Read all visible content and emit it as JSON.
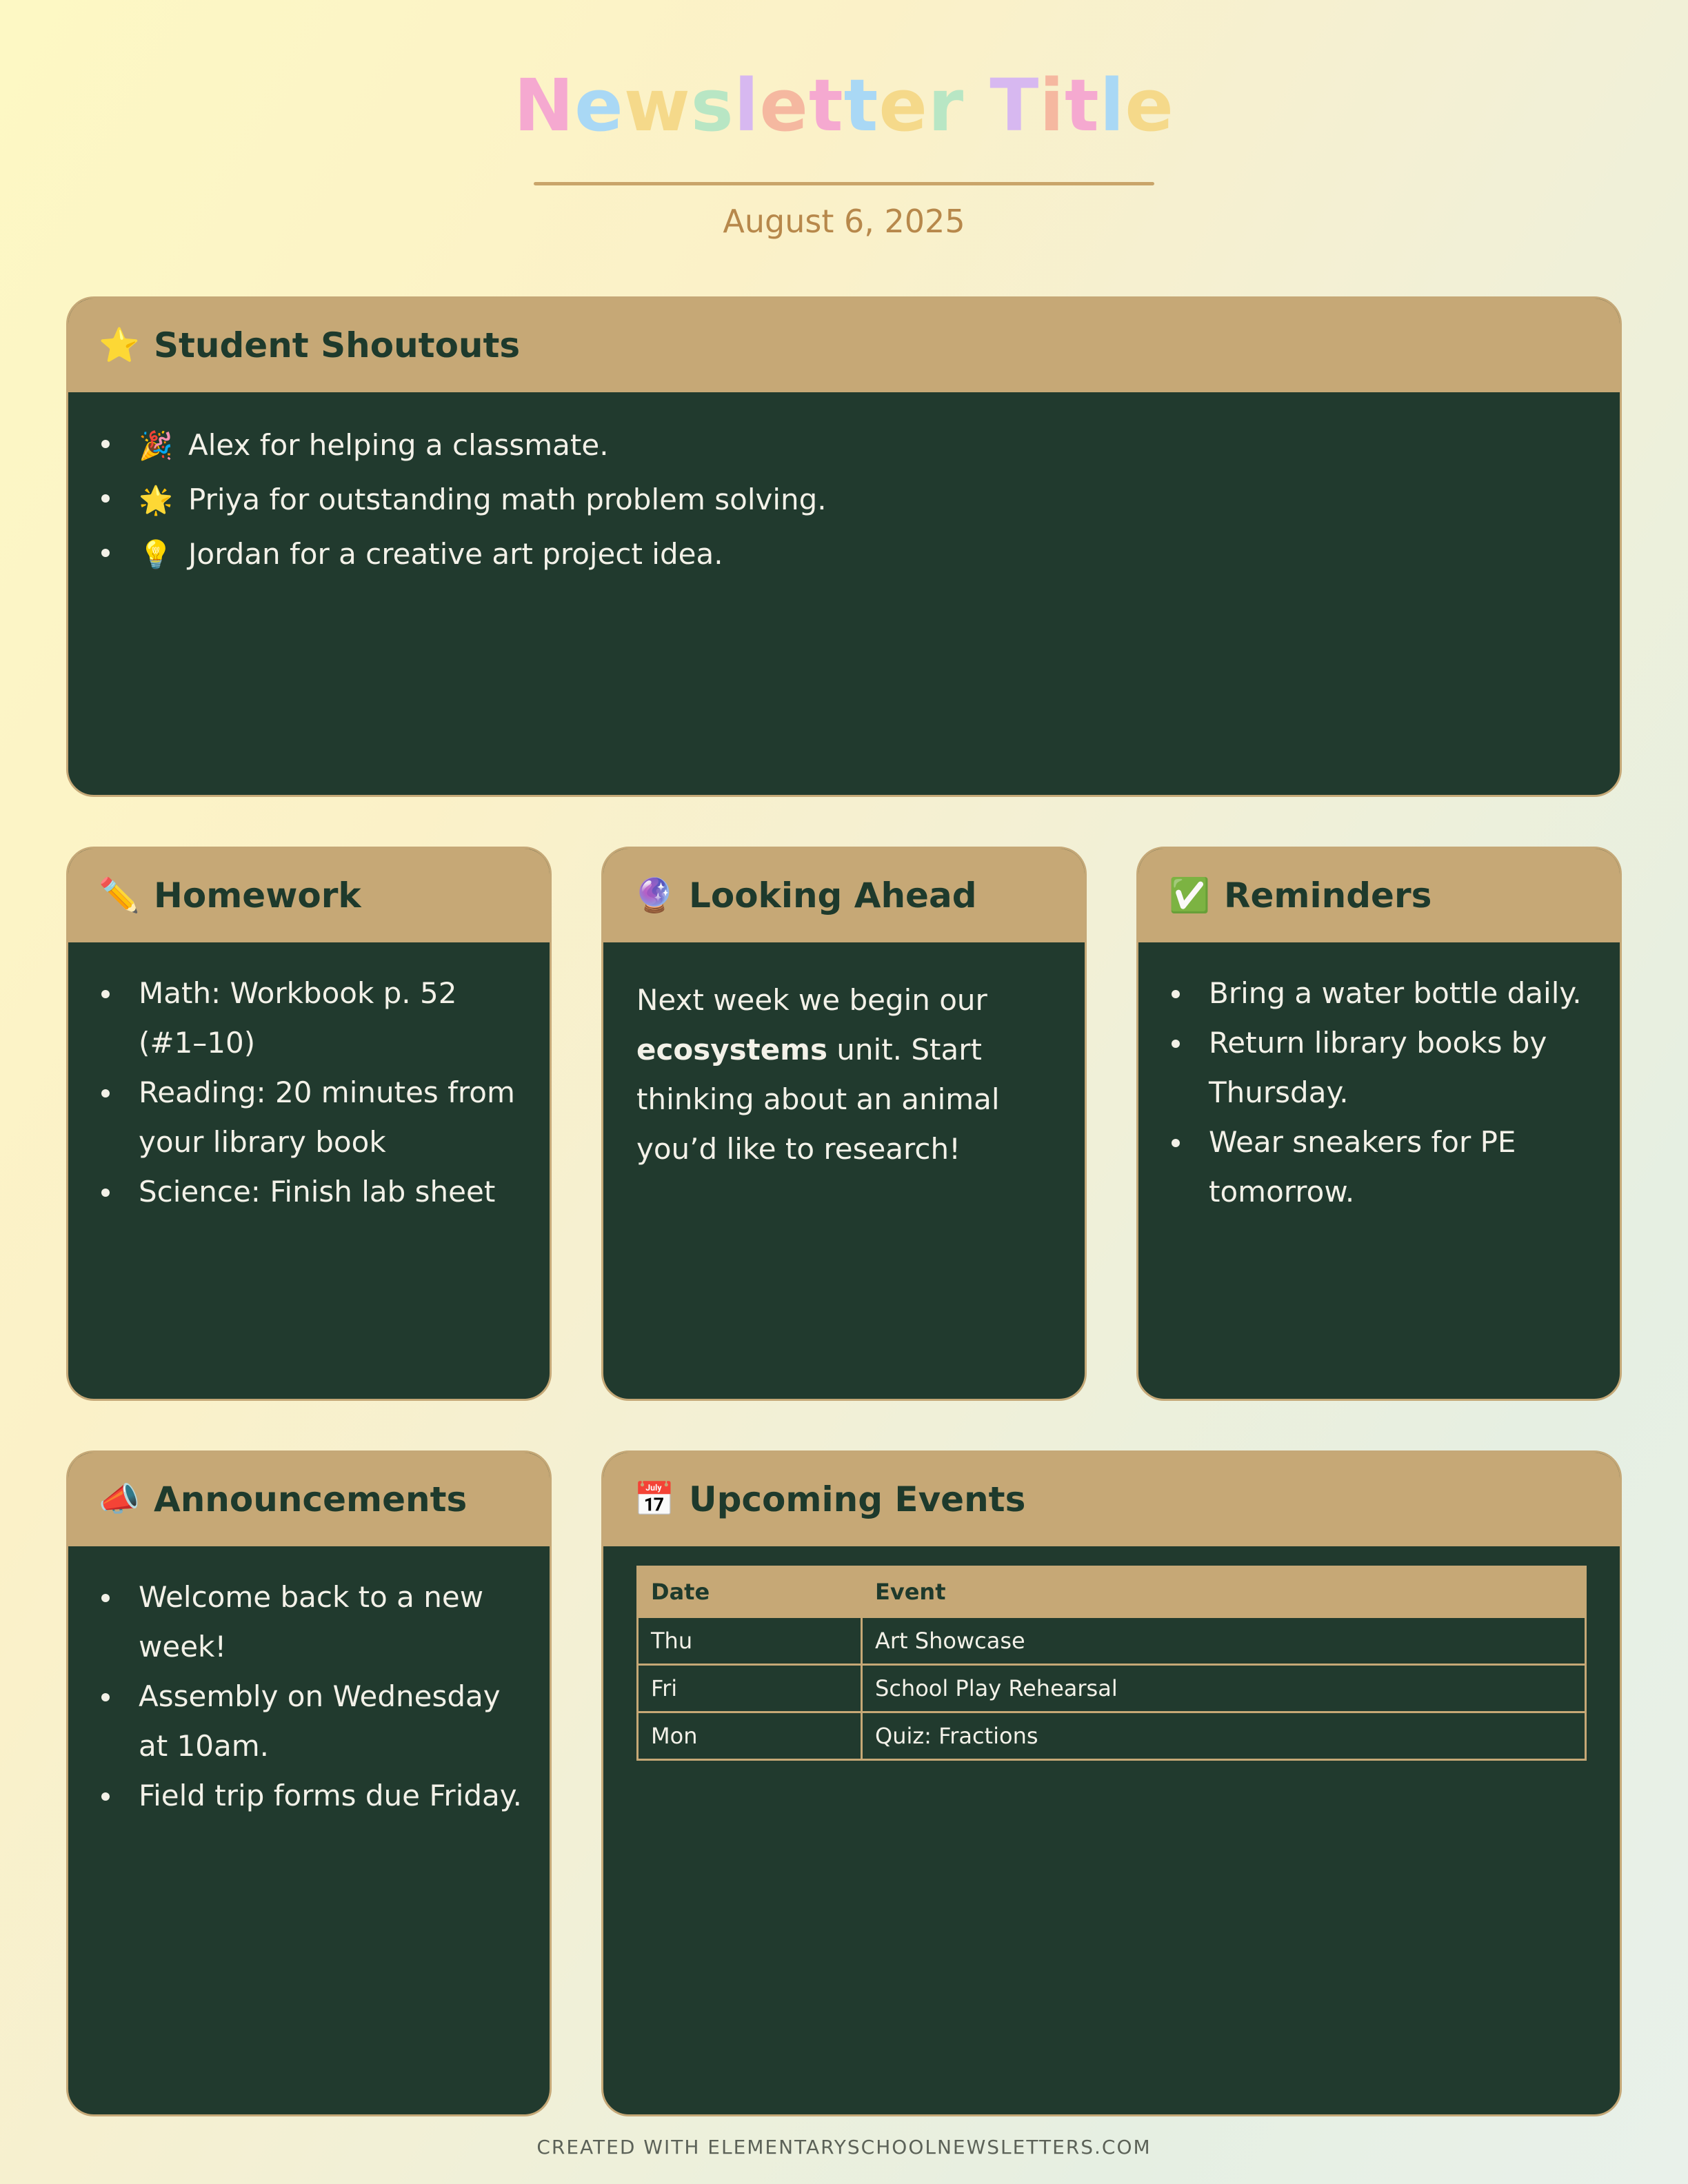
{
  "header": {
    "title": "Newsletter Title",
    "title_letter_colors": [
      "#f5a9d0",
      "#a9d8f5",
      "#f5d98a",
      "#b8e6c4",
      "#d7b8f0",
      "#f5b8a0"
    ],
    "date": "August 6, 2025"
  },
  "sections": {
    "shoutouts": {
      "icon": "star-icon",
      "icon_glyph": "⭐",
      "title": "Student Shoutouts",
      "items": [
        {
          "icon": "party-popper-icon",
          "icon_glyph": "🎉",
          "text": "Alex for helping a classmate."
        },
        {
          "icon": "glowing-star-icon",
          "icon_glyph": "🌟",
          "text": "Priya for outstanding math problem solving."
        },
        {
          "icon": "lightbulb-icon",
          "icon_glyph": "💡",
          "text": "Jordan for a creative art project idea."
        }
      ]
    },
    "homework": {
      "icon": "pencil-icon",
      "icon_glyph": "✏️",
      "title": "Homework",
      "items": [
        "Math: Workbook p. 52 (#1–10)",
        "Reading: 20 minutes from your library book",
        "Science: Finish lab sheet"
      ]
    },
    "looking_ahead": {
      "icon": "crystal-ball-icon",
      "icon_glyph": "🔮",
      "title": "Looking Ahead",
      "text_before": "Next week we begin our ",
      "text_bold": "ecosystems",
      "text_after": " unit. Start thinking about an animal you’d like to research!"
    },
    "reminders": {
      "icon": "check-mark-icon",
      "icon_glyph": "✅",
      "title": "Reminders",
      "items": [
        "Bring a water bottle daily.",
        "Return library books by Thursday.",
        "Wear sneakers for PE tomorrow."
      ]
    },
    "announcements": {
      "icon": "megaphone-icon",
      "icon_glyph": "📣",
      "title": "Announcements",
      "items": [
        "Welcome back to a new week!",
        "Assembly on Wednesday at 10am.",
        "Field trip forms due Friday."
      ]
    },
    "events": {
      "icon": "calendar-icon",
      "icon_glyph": "📅",
      "title": "Upcoming Events",
      "columns": [
        "Date",
        "Event"
      ],
      "rows": [
        [
          "Thu",
          "Art Showcase"
        ],
        [
          "Fri",
          "School Play Rehearsal"
        ],
        [
          "Mon",
          "Quiz: Fractions"
        ]
      ]
    }
  },
  "footer": {
    "text": "CREATED WITH ELEMENTARYSCHOOLNEWSLETTERS.COM"
  },
  "colors": {
    "card_background": "#213a2e",
    "card_header": "#c6a876",
    "header_text": "#1e3a2c",
    "body_text": "#f3f1e8",
    "date_text": "#b7884b"
  }
}
